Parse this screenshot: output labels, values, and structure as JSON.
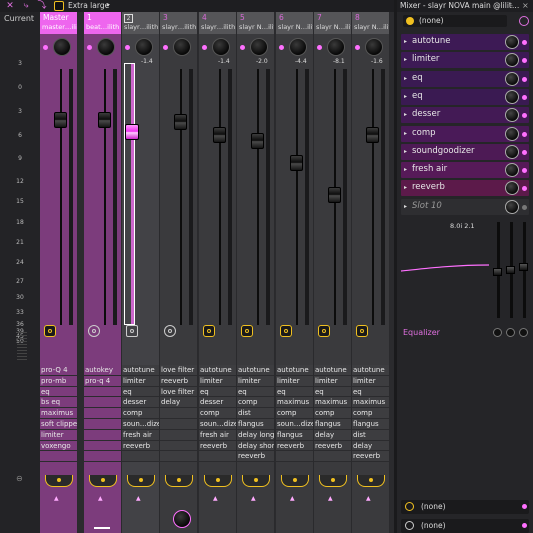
{
  "toolbar": {
    "view_size_label": "Extra large",
    "arrow": "▸"
  },
  "ruler": {
    "current_label": "Current",
    "ticks": [
      "3",
      "0",
      "3",
      "6",
      "9",
      "12",
      "15",
      "18",
      "21",
      "24",
      "27",
      "30",
      "33",
      "36",
      "39",
      "45",
      "50"
    ]
  },
  "tracks": [
    {
      "num": "Master",
      "name": "master…ilith",
      "volume": "",
      "style": "pink",
      "slots": [
        "pro-Q 4",
        "pro-mb",
        "eq",
        "bs eq",
        "maximus",
        "soft clipper",
        "limiter",
        "voxengo",
        ""
      ]
    },
    {
      "num": "1",
      "name": "beat…ilith",
      "volume": "",
      "style": "pink",
      "slots": [
        "autokey",
        "pro-q 4",
        "",
        "",
        "",
        "",
        "",
        "",
        ""
      ]
    },
    {
      "num": "2",
      "name": "slayr…ilith",
      "volume": "-1.4",
      "style": "insel",
      "slots": [
        "autotune",
        "limiter",
        "eq",
        "desser",
        "comp",
        "soun…dizer",
        "fresh air",
        "reeverb",
        ""
      ]
    },
    {
      "num": "3",
      "name": "slayr…ilith",
      "volume": "",
      "style": "normal",
      "slots": [
        "love filter",
        "reeverb",
        "love filter",
        "delay",
        "",
        "",
        "",
        "",
        ""
      ]
    },
    {
      "num": "4",
      "name": "slayr…ilith",
      "volume": "-1.4",
      "style": "normal",
      "slots": [
        "autotune",
        "limiter",
        "eq",
        "desser",
        "comp",
        "soun…dizer",
        "fresh air",
        "reeverb",
        ""
      ]
    },
    {
      "num": "5",
      "name": "slayr N…ilith",
      "volume": "-2.0",
      "style": "normal",
      "slots": [
        "autotune",
        "limiter",
        "eq",
        "comp",
        "dist",
        "flangus",
        "delay long",
        "delay short",
        "reeverb"
      ]
    },
    {
      "num": "6",
      "name": "slayr N…ilith",
      "volume": "-4.4",
      "style": "normal",
      "slots": [
        "autotune",
        "limiter",
        "eq",
        "maximus",
        "comp",
        "soun…dizer",
        "flangus",
        "reeverb",
        ""
      ]
    },
    {
      "num": "7",
      "name": "slayr N…ilith",
      "volume": "-8.1",
      "style": "normal",
      "slots": [
        "autotune",
        "limiter",
        "eq",
        "maximus",
        "comp",
        "flangus",
        "delay",
        "reeverb",
        ""
      ]
    },
    {
      "num": "8",
      "name": "slayr N…ilith",
      "volume": "-1.6",
      "style": "normal",
      "slots": [
        "autotune",
        "limiter",
        "eq",
        "maximus",
        "comp",
        "flangus",
        "dist",
        "delay",
        "reeverb"
      ]
    }
  ],
  "panel": {
    "title": "Mixer - slayr NOVA main @lilit…",
    "preset": "(none)",
    "fx": [
      {
        "name": "autotune",
        "color": "#3d1a55"
      },
      {
        "name": "limiter",
        "color": "#3d1a55"
      },
      {
        "name": "eq",
        "color": "#3a1a52"
      },
      {
        "name": "eq",
        "color": "#3a1a52"
      },
      {
        "name": "desser",
        "color": "#431a55"
      },
      {
        "name": "comp",
        "color": "#4a1a58"
      },
      {
        "name": "soundgoodizer",
        "color": "#4d1a55"
      },
      {
        "name": "fresh air",
        "color": "#561a58"
      },
      {
        "name": "reeverb",
        "color": "#5c1a4a"
      },
      {
        "name": "Slot 10",
        "color": "#2e2e31"
      }
    ],
    "eq_label": "Equalizer",
    "eq_values": "8.0i 2.1",
    "outputs": [
      "(none)",
      "(none)"
    ]
  },
  "colors": {
    "accent": "#ff70ff",
    "yellow": "#f0c020"
  }
}
